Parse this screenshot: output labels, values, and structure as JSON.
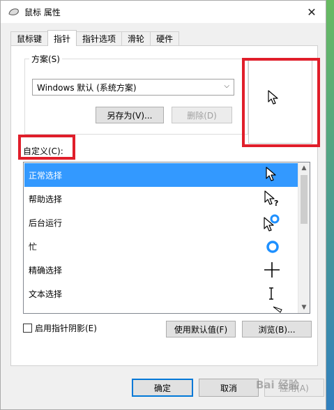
{
  "window": {
    "title": "鼠标 属性",
    "close_glyph": "✕",
    "app_icon": "mouse-icon"
  },
  "tabs": [
    {
      "label": "鼠标键",
      "active": false
    },
    {
      "label": "指针",
      "active": true
    },
    {
      "label": "指针选项",
      "active": false
    },
    {
      "label": "滑轮",
      "active": false
    },
    {
      "label": "硬件",
      "active": false
    }
  ],
  "scheme": {
    "group_label": "方案(S)",
    "selected": "Windows 默认 (系统方案)",
    "save_as_label": "另存为(V)...",
    "delete_label": "删除(D)"
  },
  "custom": {
    "label": "自定义(C):",
    "items": [
      {
        "label": "正常选择",
        "icon": "arrow-cursor-icon",
        "selected": true
      },
      {
        "label": "帮助选择",
        "icon": "help-cursor-icon",
        "selected": false
      },
      {
        "label": "后台运行",
        "icon": "working-in-background-cursor-icon",
        "selected": false
      },
      {
        "label": "忙",
        "icon": "busy-cursor-icon",
        "selected": false
      },
      {
        "label": "精确选择",
        "icon": "precision-cursor-icon",
        "selected": false
      },
      {
        "label": "文本选择",
        "icon": "text-cursor-icon",
        "selected": false
      }
    ]
  },
  "options": {
    "shadow_label": "启用指针阴影(E)",
    "shadow_checked": false,
    "use_default_label": "使用默认值(F)",
    "browse_label": "浏览(B)..."
  },
  "footer": {
    "ok_label": "确定",
    "cancel_label": "取消",
    "apply_label": "应用(A)"
  },
  "watermark": "Bai 经验",
  "colors": {
    "selection": "#3399ff",
    "highlight_box": "#e01e2a",
    "ring": "#1e90ff"
  }
}
